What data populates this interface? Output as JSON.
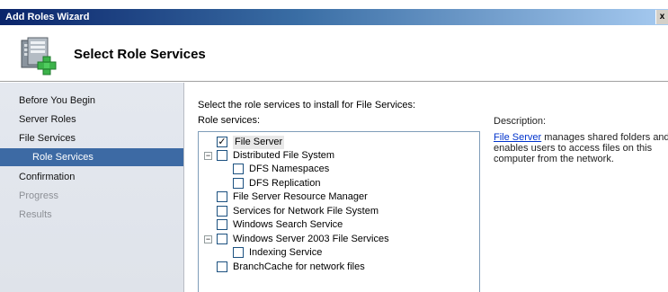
{
  "window": {
    "title": "Add Roles Wizard",
    "close_glyph": "x"
  },
  "header": {
    "title": "Select Role Services",
    "icon": "server-add-icon"
  },
  "nav": {
    "items": [
      {
        "label": "Before You Begin",
        "state": "normal"
      },
      {
        "label": "Server Roles",
        "state": "normal"
      },
      {
        "label": "File Services",
        "state": "normal"
      },
      {
        "label": "Role Services",
        "state": "active"
      },
      {
        "label": "Confirmation",
        "state": "normal"
      },
      {
        "label": "Progress",
        "state": "disabled"
      },
      {
        "label": "Results",
        "state": "disabled"
      }
    ]
  },
  "content": {
    "instruction": "Select the role services to install for File Services:",
    "role_services_label": "Role services:",
    "tree": [
      {
        "label": "File Server",
        "checked": true,
        "level": 0,
        "expander": "",
        "selected": true
      },
      {
        "label": "Distributed File System",
        "checked": false,
        "level": 0,
        "expander": "−"
      },
      {
        "label": "DFS Namespaces",
        "checked": false,
        "level": 1,
        "expander": ""
      },
      {
        "label": "DFS Replication",
        "checked": false,
        "level": 1,
        "expander": ""
      },
      {
        "label": "File Server Resource Manager",
        "checked": false,
        "level": 0,
        "expander": ""
      },
      {
        "label": "Services for Network File System",
        "checked": false,
        "level": 0,
        "expander": ""
      },
      {
        "label": "Windows Search Service",
        "checked": false,
        "level": 0,
        "expander": ""
      },
      {
        "label": "Windows Server 2003 File Services",
        "checked": false,
        "level": 0,
        "expander": "−"
      },
      {
        "label": "Indexing Service",
        "checked": false,
        "level": 1,
        "expander": ""
      },
      {
        "label": "BranchCache for network files",
        "checked": false,
        "level": 0,
        "expander": ""
      }
    ],
    "description": {
      "label": "Description:",
      "link": "File Server",
      "text": " manages shared folders and enables users to access files on this computer from the network."
    }
  }
}
